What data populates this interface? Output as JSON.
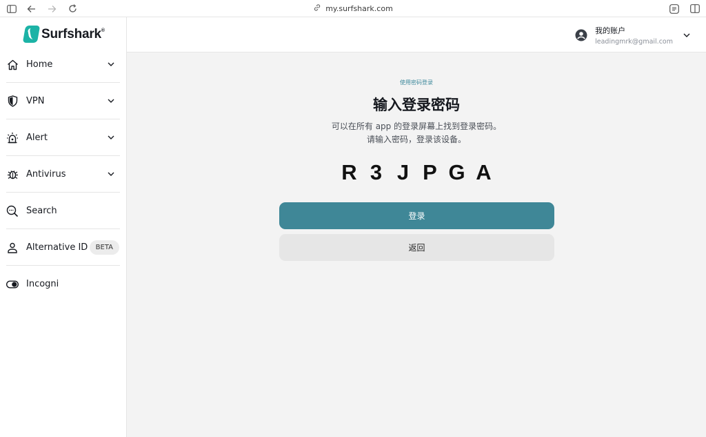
{
  "browser": {
    "url": "my.surfshark.com"
  },
  "brand": {
    "name": "Surfshark",
    "mark": "®",
    "accent": "#1cb3a6"
  },
  "sidebar": {
    "items": [
      {
        "label": "Home",
        "icon": "home-icon",
        "chevron": true
      },
      {
        "label": "VPN",
        "icon": "shield-icon",
        "chevron": true
      },
      {
        "label": "Alert",
        "icon": "alarm-icon",
        "chevron": true
      },
      {
        "label": "Antivirus",
        "icon": "bug-icon",
        "chevron": true
      },
      {
        "label": "Search",
        "icon": "search-icon",
        "chevron": false
      },
      {
        "label": "Alternative ID",
        "icon": "person-icon",
        "badge": "BETA"
      },
      {
        "label": "Incogni",
        "icon": "toggle-icon",
        "chevron": false
      }
    ]
  },
  "header": {
    "account_title": "我的账户",
    "account_email": "leadingmrk@gmail.com"
  },
  "main": {
    "eyebrow": "使用密码登录",
    "title": "输入登录密码",
    "desc_line1": "可以在所有 app 的登录屏幕上找到登录密码。",
    "desc_line2": "请输入密码，登录该设备。",
    "code": [
      "R",
      "3",
      "J",
      "P",
      "G",
      "A"
    ],
    "login_label": "登录",
    "back_label": "返回",
    "primary_color": "#3f8797"
  }
}
